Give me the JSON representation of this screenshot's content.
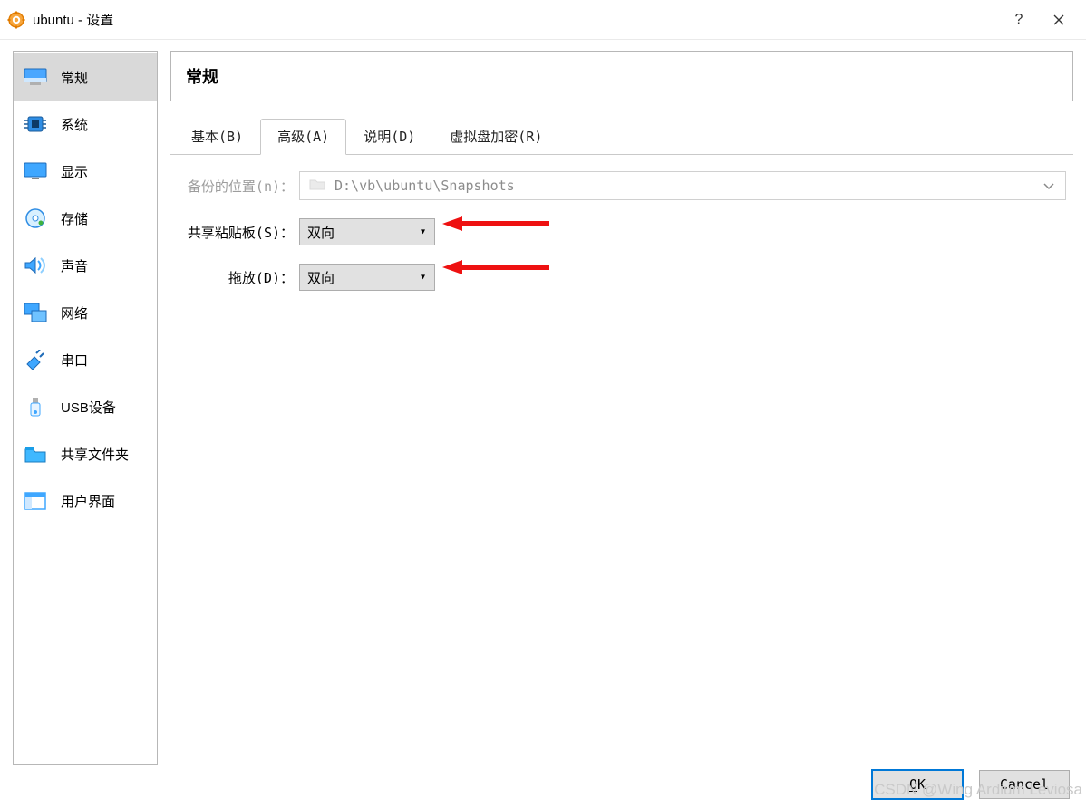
{
  "window": {
    "title": "ubuntu - 设置"
  },
  "sidebar": {
    "items": [
      {
        "id": "general",
        "label": "常规",
        "icon": "monitor",
        "active": true
      },
      {
        "id": "system",
        "label": "系统",
        "icon": "chip",
        "active": false
      },
      {
        "id": "display",
        "label": "显示",
        "icon": "screen",
        "active": false
      },
      {
        "id": "storage",
        "label": "存储",
        "icon": "disk",
        "active": false
      },
      {
        "id": "audio",
        "label": "声音",
        "icon": "speaker",
        "active": false
      },
      {
        "id": "network",
        "label": "网络",
        "icon": "net",
        "active": false
      },
      {
        "id": "serial",
        "label": "串口",
        "icon": "plug",
        "active": false
      },
      {
        "id": "usb",
        "label": "USB设备",
        "icon": "usb",
        "active": false
      },
      {
        "id": "shared",
        "label": "共享文件夹",
        "icon": "folder",
        "active": false
      },
      {
        "id": "ui",
        "label": "用户界面",
        "icon": "window",
        "active": false
      }
    ]
  },
  "panel": {
    "title": "常规",
    "tabs": [
      {
        "id": "basic",
        "label": "基本(B)",
        "active": false
      },
      {
        "id": "advanced",
        "label": "高级(A)",
        "active": true
      },
      {
        "id": "description",
        "label": "说明(D)",
        "active": false
      },
      {
        "id": "encryption",
        "label": "虚拟盘加密(R)",
        "active": false
      }
    ],
    "form": {
      "snapshot_label": "备份的位置(n)：",
      "snapshot_path": "D:\\vb\\ubuntu\\Snapshots",
      "clipboard_label": "共享粘贴板(S)：",
      "clipboard_value": "双向",
      "dragdrop_label": "拖放(D)：",
      "dragdrop_value": "双向"
    }
  },
  "footer": {
    "ok": "OK",
    "cancel": "Cancel"
  },
  "watermark": "CSDN @Wing Ardium Leviosa"
}
